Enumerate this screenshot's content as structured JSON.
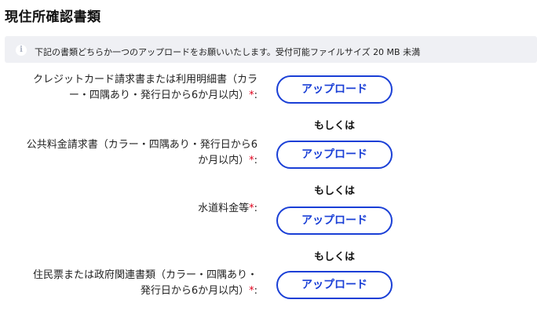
{
  "page_title": "現住所確認書類",
  "notice": {
    "icon": "info-icon",
    "text": "下記の書類どちらか一つのアップロードをお願いいたします。受付可能ファイルサイズ 20 MB 未満"
  },
  "documents": [
    {
      "label_line1": "クレジットカード請求書または利用明細書（カラ",
      "label_line2": "ー・四隅あり・発行日から6か月以内）",
      "required": "*",
      "colon": ":",
      "button": "アップロード"
    },
    {
      "label_line1": "公共料金請求書（カラー・四隅あり・発行日から6",
      "label_line2": "か月以内）",
      "required": "*",
      "colon": ":",
      "button": "アップロード"
    },
    {
      "label_line1": "水道料金等",
      "required": "*",
      "colon": ":",
      "button": "アップロード"
    },
    {
      "label_line1": "住民票または政府関連書類（カラー・四隅あり・",
      "label_line2": "発行日から6か月以内）",
      "required": "*",
      "colon": ":",
      "button": "アップロード"
    }
  ],
  "or_text": "もしくは",
  "colors": {
    "accent": "#1a3fd6",
    "required": "#e0001b",
    "notice_bg": "#eff0f4"
  }
}
